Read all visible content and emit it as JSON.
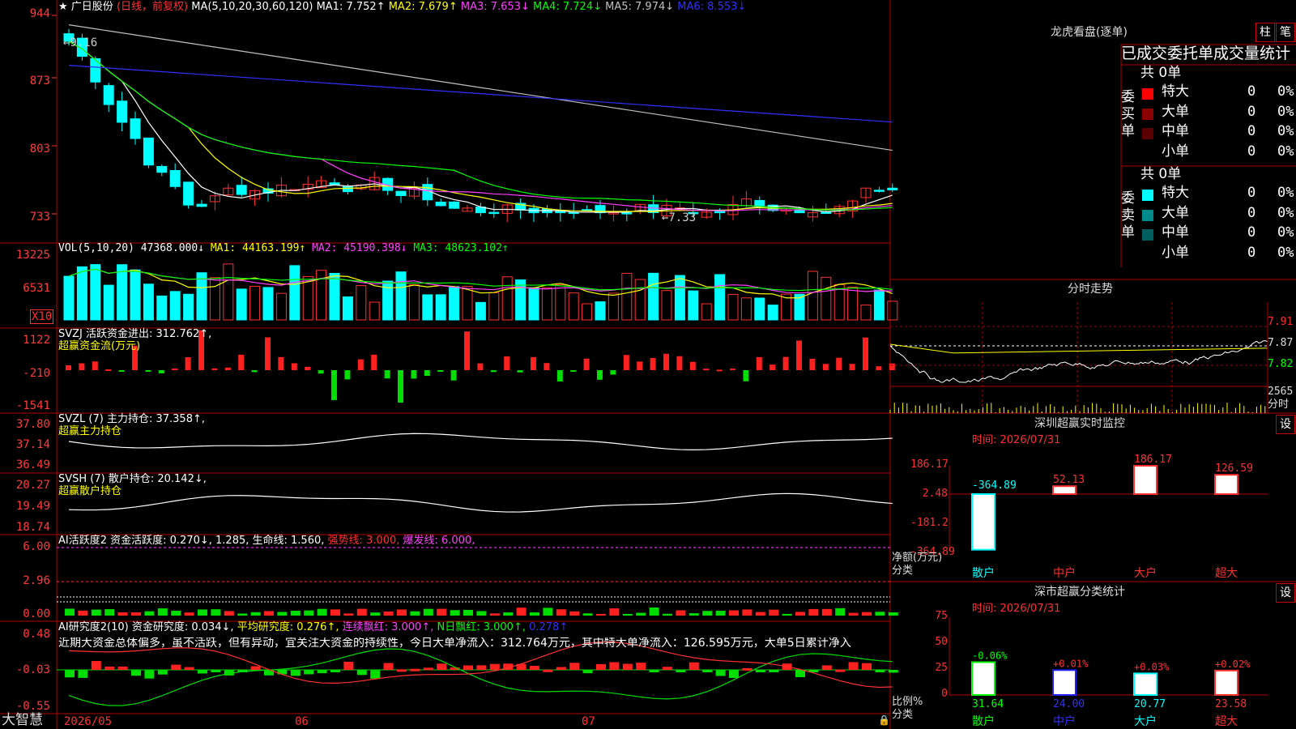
{
  "app": {
    "logo_text": "大智慧"
  },
  "main_chart": {
    "star": "★",
    "stock_name": "广日股份",
    "mode": "(日线，前复权)",
    "ma_prefix": "MA(5,10,20,30,60,120)",
    "ma": [
      {
        "text": "MA1: 7.752↑",
        "color": "#ffffff"
      },
      {
        "text": "MA2: 7.679↑",
        "color": "#ffff00"
      },
      {
        "text": "MA3: 7.653↓",
        "color": "#ff40ff"
      },
      {
        "text": "MA4: 7.724↓",
        "color": "#00ff00"
      },
      {
        "text": "MA5: 7.974↓",
        "color": "#c0c0c0"
      },
      {
        "text": "MA6: 8.553↓",
        "color": "#3030ff"
      }
    ],
    "y_ticks": [
      "944",
      "873",
      "803",
      "733"
    ],
    "high_label": "←9.16",
    "low_label": "←7.33"
  },
  "vol_panel": {
    "title": "VOL(5,10,20)",
    "items": [
      {
        "text": "47368.000↓",
        "color": "#ffffff"
      },
      {
        "text": "MA1: 44163.199↑",
        "color": "#ffff00"
      },
      {
        "text": "MA2: 45190.398↓",
        "color": "#ff40ff"
      },
      {
        "text": "MA3: 48623.102↑",
        "color": "#00ff00"
      }
    ],
    "y_ticks": [
      "13225",
      "6531"
    ],
    "unit": "X10"
  },
  "svzj_panel": {
    "line1": "SVZJ  活跃资金进出: 312.762↑,",
    "line2": "超赢资金流(万元)",
    "y_ticks": [
      "1122",
      "-210",
      "-1541"
    ]
  },
  "svzl_panel": {
    "line1": "SVZL (7) 主力持仓: 37.358↑,",
    "line2": "超赢主力持仓",
    "y_ticks": [
      "37.80",
      "37.14",
      "36.49"
    ]
  },
  "svsh_panel": {
    "line1": "SVSH (7) 散户持仓: 20.142↓,",
    "line2": "超赢散户持仓",
    "y_ticks": [
      "20.27",
      "19.49",
      "18.74"
    ]
  },
  "ai_active_panel": {
    "items": [
      {
        "text": "AI活跃度2 资金活跃度: 0.270↓,",
        "color": "#ffffff"
      },
      {
        "text": "1.285,",
        "color": "#ffffff"
      },
      {
        "text": "生命线: 1.560,",
        "color": "#ffffff"
      },
      {
        "text": "强势线: 3.000,",
        "color": "#ff3030"
      },
      {
        "text": "爆发线: 6.000,",
        "color": "#ff40ff"
      }
    ],
    "y_ticks": [
      "6.00",
      "2.96",
      "0.00"
    ]
  },
  "ai_research_panel": {
    "items": [
      {
        "text": "AI研究度2(10) 资金研究度: 0.034↓,",
        "color": "#ffffff"
      },
      {
        "text": "平均研究度: 0.276↑,",
        "color": "#ffff00"
      },
      {
        "text": "连续飘红: 3.000↑,",
        "color": "#ff40ff"
      },
      {
        "text": "N日飘红: 3.000↑,",
        "color": "#00ff00"
      },
      {
        "text": "0.278↑",
        "color": "#3030ff"
      }
    ],
    "comment": "近期大资金总体偏多，虽不活跃，但有异动，宜关注大资金的持续性，今日大单净流入：312.764万元，其中特大单净流入：126.595万元，大单5日累计净入",
    "y_ticks": [
      "0.48",
      "-0.03",
      "-0.55"
    ]
  },
  "x_axis": {
    "labels": [
      "2026/05",
      "06",
      "07"
    ]
  },
  "dragon_tiger": {
    "title": "龙虎看盘(逐单)",
    "btn_bar": "柱",
    "btn_pen": "笔",
    "subtitle": "已成交委托单成交量统计",
    "buy_side": {
      "label": "委买单",
      "total": "共 0单",
      "rows": [
        {
          "name": "特大",
          "count": "0",
          "pct": "0%",
          "color": "#ff0000"
        },
        {
          "name": "大单",
          "count": "0",
          "pct": "0%",
          "color": "#8b0000"
        },
        {
          "name": "中单",
          "count": "0",
          "pct": "0%",
          "color": "#5a0000"
        },
        {
          "name": "小单",
          "count": "0",
          "pct": "0%",
          "color": "#000000"
        }
      ]
    },
    "sell_side": {
      "label": "委卖单",
      "total": "共 0单",
      "rows": [
        {
          "name": "特大",
          "count": "0",
          "pct": "0%",
          "color": "#00ffff"
        },
        {
          "name": "大单",
          "count": "0",
          "pct": "0%",
          "color": "#008b8b"
        },
        {
          "name": "中单",
          "count": "0",
          "pct": "0%",
          "color": "#006060"
        },
        {
          "name": "小单",
          "count": "0",
          "pct": "0%",
          "color": "#000000"
        }
      ]
    }
  },
  "intraday": {
    "title": "分时走势",
    "y_ticks": [
      "7.91",
      "7.87",
      "7.82"
    ],
    "vol_label": "2565",
    "unit_label": "分时"
  },
  "sz_monitor": {
    "title": "深圳超赢实时监控",
    "settings": "设",
    "time_label": "时间: 2026/07/31",
    "y_ticks": [
      "186.17",
      "2.48",
      "-181.2",
      "-364.89"
    ],
    "unit_label": "净额(万元)",
    "category_label": "分类",
    "bars": [
      {
        "name": "散户",
        "value": -364.89,
        "label": "-364.89",
        "label_color": "#00ffff",
        "name_color": "#00ffff",
        "fill": "#00ffff"
      },
      {
        "name": "中户",
        "value": 52.13,
        "label": "52.13",
        "label_color": "#ff3030",
        "name_color": "#ff3030",
        "fill": "#ff3030"
      },
      {
        "name": "大户",
        "value": 186.17,
        "label": "186.17",
        "label_color": "#ff3030",
        "name_color": "#ff3030",
        "fill": "#ff3030"
      },
      {
        "name": "超大",
        "value": 126.59,
        "label": "126.59",
        "label_color": "#ff3030",
        "name_color": "#ff3030",
        "fill": "#ff3030"
      }
    ]
  },
  "sz_classify": {
    "title": "深市超赢分类统计",
    "settings": "设",
    "time_label": "时间: 2026/07/31",
    "y_ticks": [
      "75",
      "50",
      "25",
      "0"
    ],
    "unit_label": "比例%",
    "category_label": "分类",
    "bars": [
      {
        "name": "散户",
        "value": 31.64,
        "value_label": "31.64",
        "change": "-0.06%",
        "change_color": "#00ff00",
        "value_color": "#00ff00",
        "name_color": "#00ff00",
        "fill": "#00ff00"
      },
      {
        "name": "中户",
        "value": 24.0,
        "value_label": "24.00",
        "change": "+0.01%",
        "change_color": "#ff3030",
        "value_color": "#3030ff",
        "name_color": "#3030ff",
        "fill": "#2020ff"
      },
      {
        "name": "大户",
        "value": 20.77,
        "value_label": "20.77",
        "change": "+0.03%",
        "change_color": "#ff3030",
        "value_color": "#00ffff",
        "name_color": "#00ffff",
        "fill": "#00ffff"
      },
      {
        "name": "超大",
        "value": 23.58,
        "value_label": "23.58",
        "change": "+0.02%",
        "change_color": "#ff3030",
        "value_color": "#ff3030",
        "name_color": "#ff3030",
        "fill": "#ff3030"
      }
    ]
  }
}
